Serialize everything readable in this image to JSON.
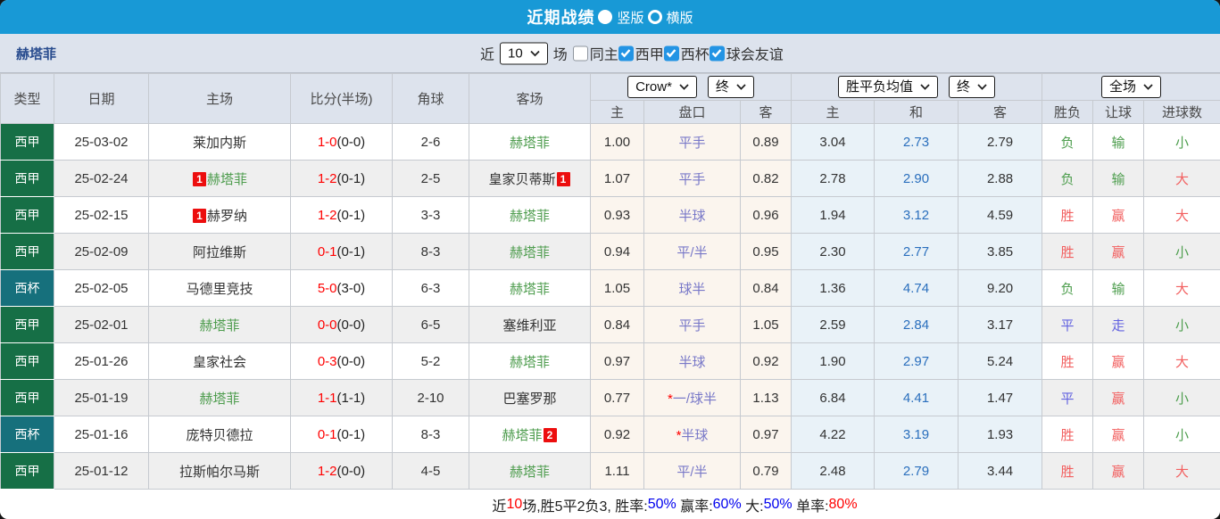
{
  "colors": {
    "topbar_blue": "#1899d6",
    "league_green": "#166f46",
    "cup_teal": "#16707c",
    "team_green": "#4f9d4f",
    "score_red": "#ff0000",
    "result_red": "#f25f5f",
    "result_green": "#4e9e4e",
    "result_blue": "#6262e0",
    "handicap_purple": "#7878c8",
    "avg_draw_blue": "#2a6fbd",
    "checkbox_blue": "#2394e4",
    "summary_blue": "#0000ee",
    "summary_red": "#ff0000"
  },
  "topbar": {
    "title": "近期战绩",
    "radios": [
      {
        "label": "竖版",
        "selected": true
      },
      {
        "label": "横版",
        "selected": false
      }
    ]
  },
  "filterbar": {
    "team": "赫塔菲",
    "near_label": "近",
    "near_value": "10",
    "games_label": "场",
    "checkboxes": [
      {
        "key": "same-home",
        "label": "同主",
        "checked": false
      },
      {
        "key": "la-liga",
        "label": "西甲",
        "checked": true
      },
      {
        "key": "copa-del-rey",
        "label": "西杯",
        "checked": true
      },
      {
        "key": "club-friendly",
        "label": "球会友谊",
        "checked": true
      }
    ]
  },
  "table": {
    "left_headers": [
      "类型",
      "日期",
      "主场",
      "比分(半场)",
      "角球",
      "客场"
    ],
    "dropdowns": {
      "company": "Crow*",
      "company_time": "终",
      "avg": "胜平负均值",
      "avg_time": "终",
      "scope": "全场"
    },
    "sub_headers": [
      "主",
      "盘口",
      "客",
      "主",
      "和",
      "客",
      "胜负",
      "让球",
      "进球数"
    ],
    "rows": [
      {
        "kind": "league",
        "type": "西甲",
        "date": "25-03-02",
        "home": {
          "name": "莱加内斯",
          "green": false,
          "badge": ""
        },
        "score": {
          "full": "1-0",
          "half": "(0-0)"
        },
        "corners": "2-6",
        "away": {
          "name": "赫塔菲",
          "green": true,
          "badge": ""
        },
        "odds": {
          "home": "1.00",
          "line": "平手",
          "star": false,
          "away": "0.89"
        },
        "avg": {
          "home": "3.04",
          "draw": "2.73",
          "away": "2.79"
        },
        "results": [
          {
            "text": "负",
            "color": "green"
          },
          {
            "text": "输",
            "color": "green"
          },
          {
            "text": "小",
            "color": "green"
          }
        ]
      },
      {
        "kind": "league",
        "type": "西甲",
        "date": "25-02-24",
        "home": {
          "name": "赫塔菲",
          "green": true,
          "badge": "1"
        },
        "score": {
          "full": "1-2",
          "half": "(0-1)"
        },
        "corners": "2-5",
        "away": {
          "name": "皇家贝蒂斯",
          "green": false,
          "badge": "1"
        },
        "odds": {
          "home": "1.07",
          "line": "平手",
          "star": false,
          "away": "0.82"
        },
        "avg": {
          "home": "2.78",
          "draw": "2.90",
          "away": "2.88"
        },
        "results": [
          {
            "text": "负",
            "color": "green"
          },
          {
            "text": "输",
            "color": "green"
          },
          {
            "text": "大",
            "color": "red"
          }
        ]
      },
      {
        "kind": "league",
        "type": "西甲",
        "date": "25-02-15",
        "home": {
          "name": "赫罗纳",
          "green": false,
          "badge": "1"
        },
        "score": {
          "full": "1-2",
          "half": "(0-1)"
        },
        "corners": "3-3",
        "away": {
          "name": "赫塔菲",
          "green": true,
          "badge": ""
        },
        "odds": {
          "home": "0.93",
          "line": "半球",
          "star": false,
          "away": "0.96"
        },
        "avg": {
          "home": "1.94",
          "draw": "3.12",
          "away": "4.59"
        },
        "results": [
          {
            "text": "胜",
            "color": "red"
          },
          {
            "text": "赢",
            "color": "red"
          },
          {
            "text": "大",
            "color": "red"
          }
        ]
      },
      {
        "kind": "league",
        "type": "西甲",
        "date": "25-02-09",
        "home": {
          "name": "阿拉维斯",
          "green": false,
          "badge": ""
        },
        "score": {
          "full": "0-1",
          "half": "(0-1)"
        },
        "corners": "8-3",
        "away": {
          "name": "赫塔菲",
          "green": true,
          "badge": ""
        },
        "odds": {
          "home": "0.94",
          "line": "平/半",
          "star": false,
          "away": "0.95"
        },
        "avg": {
          "home": "2.30",
          "draw": "2.77",
          "away": "3.85"
        },
        "results": [
          {
            "text": "胜",
            "color": "red"
          },
          {
            "text": "赢",
            "color": "red"
          },
          {
            "text": "小",
            "color": "green"
          }
        ]
      },
      {
        "kind": "cup",
        "type": "西杯",
        "date": "25-02-05",
        "home": {
          "name": "马德里竞技",
          "green": false,
          "badge": ""
        },
        "score": {
          "full": "5-0",
          "half": "(3-0)"
        },
        "corners": "6-3",
        "away": {
          "name": "赫塔菲",
          "green": true,
          "badge": ""
        },
        "odds": {
          "home": "1.05",
          "line": "球半",
          "star": false,
          "away": "0.84"
        },
        "avg": {
          "home": "1.36",
          "draw": "4.74",
          "away": "9.20"
        },
        "results": [
          {
            "text": "负",
            "color": "green"
          },
          {
            "text": "输",
            "color": "green"
          },
          {
            "text": "大",
            "color": "red"
          }
        ]
      },
      {
        "kind": "league",
        "type": "西甲",
        "date": "25-02-01",
        "home": {
          "name": "赫塔菲",
          "green": true,
          "badge": ""
        },
        "score": {
          "full": "0-0",
          "half": "(0-0)"
        },
        "corners": "6-5",
        "away": {
          "name": "塞维利亚",
          "green": false,
          "badge": ""
        },
        "odds": {
          "home": "0.84",
          "line": "平手",
          "star": false,
          "away": "1.05"
        },
        "avg": {
          "home": "2.59",
          "draw": "2.84",
          "away": "3.17"
        },
        "results": [
          {
            "text": "平",
            "color": "blue"
          },
          {
            "text": "走",
            "color": "blue"
          },
          {
            "text": "小",
            "color": "green"
          }
        ]
      },
      {
        "kind": "league",
        "type": "西甲",
        "date": "25-01-26",
        "home": {
          "name": "皇家社会",
          "green": false,
          "badge": ""
        },
        "score": {
          "full": "0-3",
          "half": "(0-0)"
        },
        "corners": "5-2",
        "away": {
          "name": "赫塔菲",
          "green": true,
          "badge": ""
        },
        "odds": {
          "home": "0.97",
          "line": "半球",
          "star": false,
          "away": "0.92"
        },
        "avg": {
          "home": "1.90",
          "draw": "2.97",
          "away": "5.24"
        },
        "results": [
          {
            "text": "胜",
            "color": "red"
          },
          {
            "text": "赢",
            "color": "red"
          },
          {
            "text": "大",
            "color": "red"
          }
        ]
      },
      {
        "kind": "league",
        "type": "西甲",
        "date": "25-01-19",
        "home": {
          "name": "赫塔菲",
          "green": true,
          "badge": ""
        },
        "score": {
          "full": "1-1",
          "half": "(1-1)"
        },
        "corners": "2-10",
        "away": {
          "name": "巴塞罗那",
          "green": false,
          "badge": ""
        },
        "odds": {
          "home": "0.77",
          "line": "一/球半",
          "star": true,
          "away": "1.13"
        },
        "avg": {
          "home": "6.84",
          "draw": "4.41",
          "away": "1.47"
        },
        "results": [
          {
            "text": "平",
            "color": "blue"
          },
          {
            "text": "赢",
            "color": "red"
          },
          {
            "text": "小",
            "color": "green"
          }
        ]
      },
      {
        "kind": "cup",
        "type": "西杯",
        "date": "25-01-16",
        "home": {
          "name": "庞特贝德拉",
          "green": false,
          "badge": ""
        },
        "score": {
          "full": "0-1",
          "half": "(0-1)"
        },
        "corners": "8-3",
        "away": {
          "name": "赫塔菲",
          "green": true,
          "badge": "2"
        },
        "odds": {
          "home": "0.92",
          "line": "半球",
          "star": true,
          "away": "0.97"
        },
        "avg": {
          "home": "4.22",
          "draw": "3.19",
          "away": "1.93"
        },
        "results": [
          {
            "text": "胜",
            "color": "red"
          },
          {
            "text": "赢",
            "color": "red"
          },
          {
            "text": "小",
            "color": "green"
          }
        ]
      },
      {
        "kind": "league",
        "type": "西甲",
        "date": "25-01-12",
        "home": {
          "name": "拉斯帕尔马斯",
          "green": false,
          "badge": ""
        },
        "score": {
          "full": "1-2",
          "half": "(0-0)"
        },
        "corners": "4-5",
        "away": {
          "name": "赫塔菲",
          "green": true,
          "badge": ""
        },
        "odds": {
          "home": "1.11",
          "line": "平/半",
          "star": false,
          "away": "0.79"
        },
        "avg": {
          "home": "2.48",
          "draw": "2.79",
          "away": "3.44"
        },
        "results": [
          {
            "text": "胜",
            "color": "red"
          },
          {
            "text": "赢",
            "color": "red"
          },
          {
            "text": "大",
            "color": "red"
          }
        ]
      }
    ]
  },
  "summary": {
    "segments": [
      {
        "text": "近",
        "color": "black"
      },
      {
        "text": "10",
        "color": "red"
      },
      {
        "text": "场,胜5平2负3, 胜率:",
        "color": "black"
      },
      {
        "text": "50%",
        "color": "blue"
      },
      {
        "text": " 赢率:",
        "color": "black"
      },
      {
        "text": "60%",
        "color": "blue"
      },
      {
        "text": " 大:",
        "color": "black"
      },
      {
        "text": "50%",
        "color": "blue"
      },
      {
        "text": " 单率:",
        "color": "black"
      },
      {
        "text": "80%",
        "color": "red"
      }
    ]
  }
}
